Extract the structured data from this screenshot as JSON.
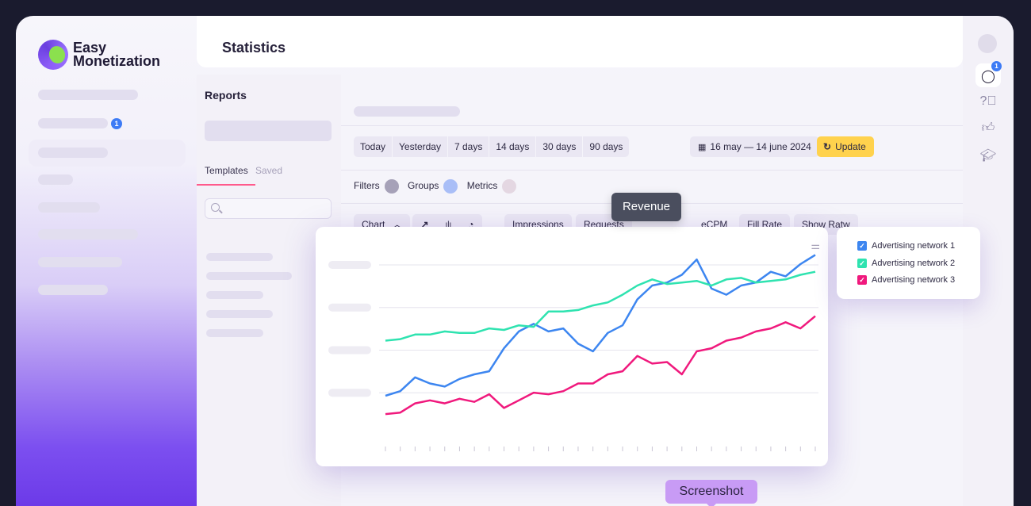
{
  "app": {
    "name_line1": "Easy",
    "name_line2": "Monetization"
  },
  "header": {
    "title": "Statistics"
  },
  "sidebar": {
    "badge_count": "1"
  },
  "reports": {
    "title": "Reports",
    "tabs": [
      {
        "label": "Templates"
      },
      {
        "label": "Saved"
      }
    ]
  },
  "periods": [
    "Today",
    "Yesterday",
    "7 days",
    "14 days",
    "30 days",
    "90 days"
  ],
  "date_range": "16 may — 14 june 2024",
  "update_label": "Update",
  "filters": {
    "filters_label": "Filters",
    "groups_label": "Groups",
    "metrics_label": "Metrics"
  },
  "metric_tabs": {
    "chart_label": "Chart",
    "impressions": "Impressions",
    "requests": "Requests",
    "ecpm": "eCPM",
    "fill_rate": "Fill Rate",
    "show_rate": "Show Ratw"
  },
  "tooltip": "Revenue",
  "rail": {
    "chat_badge": "1"
  },
  "screenshot_label": "Screenshot",
  "colors": {
    "blue": "#3d86f0",
    "green": "#2fe3b0",
    "pink": "#f0197d",
    "accent": "#ffd24d"
  },
  "chart_data": {
    "type": "line",
    "x_count": 30,
    "series": [
      {
        "name": "Advertising network 1",
        "color": "#3d86f0",
        "values": [
          14,
          17,
          26,
          22,
          20,
          25,
          28,
          30,
          45,
          56,
          61,
          56,
          58,
          48,
          43,
          55,
          60,
          77,
          86,
          88,
          93,
          103,
          84,
          80,
          86,
          88,
          95,
          92,
          100,
          106
        ]
      },
      {
        "name": "Advertising network 2",
        "color": "#2fe3b0",
        "values": [
          50,
          51,
          54,
          54,
          56,
          55,
          55,
          58,
          57,
          60,
          59,
          69,
          69,
          70,
          73,
          75,
          80,
          86,
          90,
          87,
          88,
          89,
          86,
          90,
          91,
          88,
          89,
          90,
          93,
          95
        ]
      },
      {
        "name": "Advertising network 3",
        "color": "#f0197d",
        "values": [
          2,
          3,
          9,
          11,
          9,
          12,
          10,
          15,
          6,
          11,
          16,
          15,
          17,
          22,
          22,
          28,
          30,
          40,
          35,
          36,
          28,
          43,
          45,
          50,
          52,
          56,
          58,
          62,
          58,
          66
        ]
      }
    ]
  }
}
